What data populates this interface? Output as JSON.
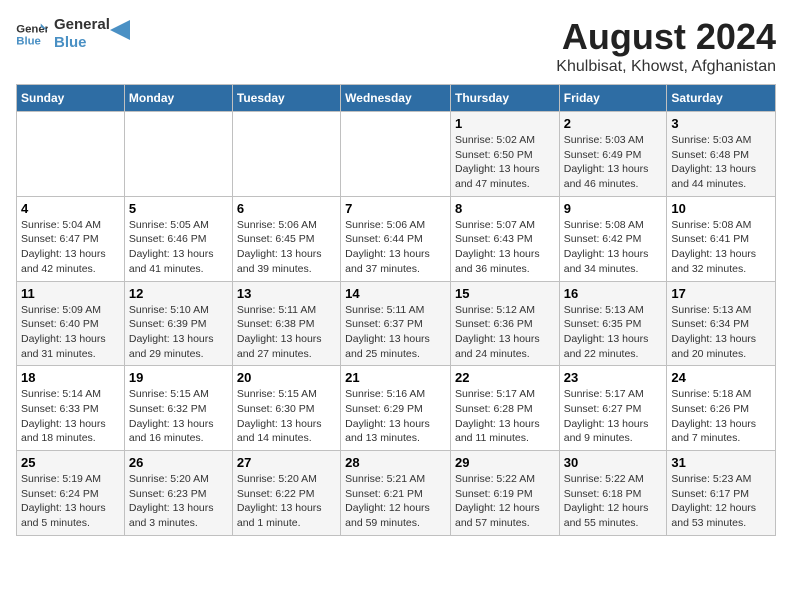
{
  "header": {
    "logo_line1": "General",
    "logo_line2": "Blue",
    "main_title": "August 2024",
    "subtitle": "Khulbisat, Khowst, Afghanistan"
  },
  "weekdays": [
    "Sunday",
    "Monday",
    "Tuesday",
    "Wednesday",
    "Thursday",
    "Friday",
    "Saturday"
  ],
  "weeks": [
    [
      {
        "num": "",
        "info": ""
      },
      {
        "num": "",
        "info": ""
      },
      {
        "num": "",
        "info": ""
      },
      {
        "num": "",
        "info": ""
      },
      {
        "num": "1",
        "info": "Sunrise: 5:02 AM\nSunset: 6:50 PM\nDaylight: 13 hours\nand 47 minutes."
      },
      {
        "num": "2",
        "info": "Sunrise: 5:03 AM\nSunset: 6:49 PM\nDaylight: 13 hours\nand 46 minutes."
      },
      {
        "num": "3",
        "info": "Sunrise: 5:03 AM\nSunset: 6:48 PM\nDaylight: 13 hours\nand 44 minutes."
      }
    ],
    [
      {
        "num": "4",
        "info": "Sunrise: 5:04 AM\nSunset: 6:47 PM\nDaylight: 13 hours\nand 42 minutes."
      },
      {
        "num": "5",
        "info": "Sunrise: 5:05 AM\nSunset: 6:46 PM\nDaylight: 13 hours\nand 41 minutes."
      },
      {
        "num": "6",
        "info": "Sunrise: 5:06 AM\nSunset: 6:45 PM\nDaylight: 13 hours\nand 39 minutes."
      },
      {
        "num": "7",
        "info": "Sunrise: 5:06 AM\nSunset: 6:44 PM\nDaylight: 13 hours\nand 37 minutes."
      },
      {
        "num": "8",
        "info": "Sunrise: 5:07 AM\nSunset: 6:43 PM\nDaylight: 13 hours\nand 36 minutes."
      },
      {
        "num": "9",
        "info": "Sunrise: 5:08 AM\nSunset: 6:42 PM\nDaylight: 13 hours\nand 34 minutes."
      },
      {
        "num": "10",
        "info": "Sunrise: 5:08 AM\nSunset: 6:41 PM\nDaylight: 13 hours\nand 32 minutes."
      }
    ],
    [
      {
        "num": "11",
        "info": "Sunrise: 5:09 AM\nSunset: 6:40 PM\nDaylight: 13 hours\nand 31 minutes."
      },
      {
        "num": "12",
        "info": "Sunrise: 5:10 AM\nSunset: 6:39 PM\nDaylight: 13 hours\nand 29 minutes."
      },
      {
        "num": "13",
        "info": "Sunrise: 5:11 AM\nSunset: 6:38 PM\nDaylight: 13 hours\nand 27 minutes."
      },
      {
        "num": "14",
        "info": "Sunrise: 5:11 AM\nSunset: 6:37 PM\nDaylight: 13 hours\nand 25 minutes."
      },
      {
        "num": "15",
        "info": "Sunrise: 5:12 AM\nSunset: 6:36 PM\nDaylight: 13 hours\nand 24 minutes."
      },
      {
        "num": "16",
        "info": "Sunrise: 5:13 AM\nSunset: 6:35 PM\nDaylight: 13 hours\nand 22 minutes."
      },
      {
        "num": "17",
        "info": "Sunrise: 5:13 AM\nSunset: 6:34 PM\nDaylight: 13 hours\nand 20 minutes."
      }
    ],
    [
      {
        "num": "18",
        "info": "Sunrise: 5:14 AM\nSunset: 6:33 PM\nDaylight: 13 hours\nand 18 minutes."
      },
      {
        "num": "19",
        "info": "Sunrise: 5:15 AM\nSunset: 6:32 PM\nDaylight: 13 hours\nand 16 minutes."
      },
      {
        "num": "20",
        "info": "Sunrise: 5:15 AM\nSunset: 6:30 PM\nDaylight: 13 hours\nand 14 minutes."
      },
      {
        "num": "21",
        "info": "Sunrise: 5:16 AM\nSunset: 6:29 PM\nDaylight: 13 hours\nand 13 minutes."
      },
      {
        "num": "22",
        "info": "Sunrise: 5:17 AM\nSunset: 6:28 PM\nDaylight: 13 hours\nand 11 minutes."
      },
      {
        "num": "23",
        "info": "Sunrise: 5:17 AM\nSunset: 6:27 PM\nDaylight: 13 hours\nand 9 minutes."
      },
      {
        "num": "24",
        "info": "Sunrise: 5:18 AM\nSunset: 6:26 PM\nDaylight: 13 hours\nand 7 minutes."
      }
    ],
    [
      {
        "num": "25",
        "info": "Sunrise: 5:19 AM\nSunset: 6:24 PM\nDaylight: 13 hours\nand 5 minutes."
      },
      {
        "num": "26",
        "info": "Sunrise: 5:20 AM\nSunset: 6:23 PM\nDaylight: 13 hours\nand 3 minutes."
      },
      {
        "num": "27",
        "info": "Sunrise: 5:20 AM\nSunset: 6:22 PM\nDaylight: 13 hours\nand 1 minute."
      },
      {
        "num": "28",
        "info": "Sunrise: 5:21 AM\nSunset: 6:21 PM\nDaylight: 12 hours\nand 59 minutes."
      },
      {
        "num": "29",
        "info": "Sunrise: 5:22 AM\nSunset: 6:19 PM\nDaylight: 12 hours\nand 57 minutes."
      },
      {
        "num": "30",
        "info": "Sunrise: 5:22 AM\nSunset: 6:18 PM\nDaylight: 12 hours\nand 55 minutes."
      },
      {
        "num": "31",
        "info": "Sunrise: 5:23 AM\nSunset: 6:17 PM\nDaylight: 12 hours\nand 53 minutes."
      }
    ]
  ]
}
